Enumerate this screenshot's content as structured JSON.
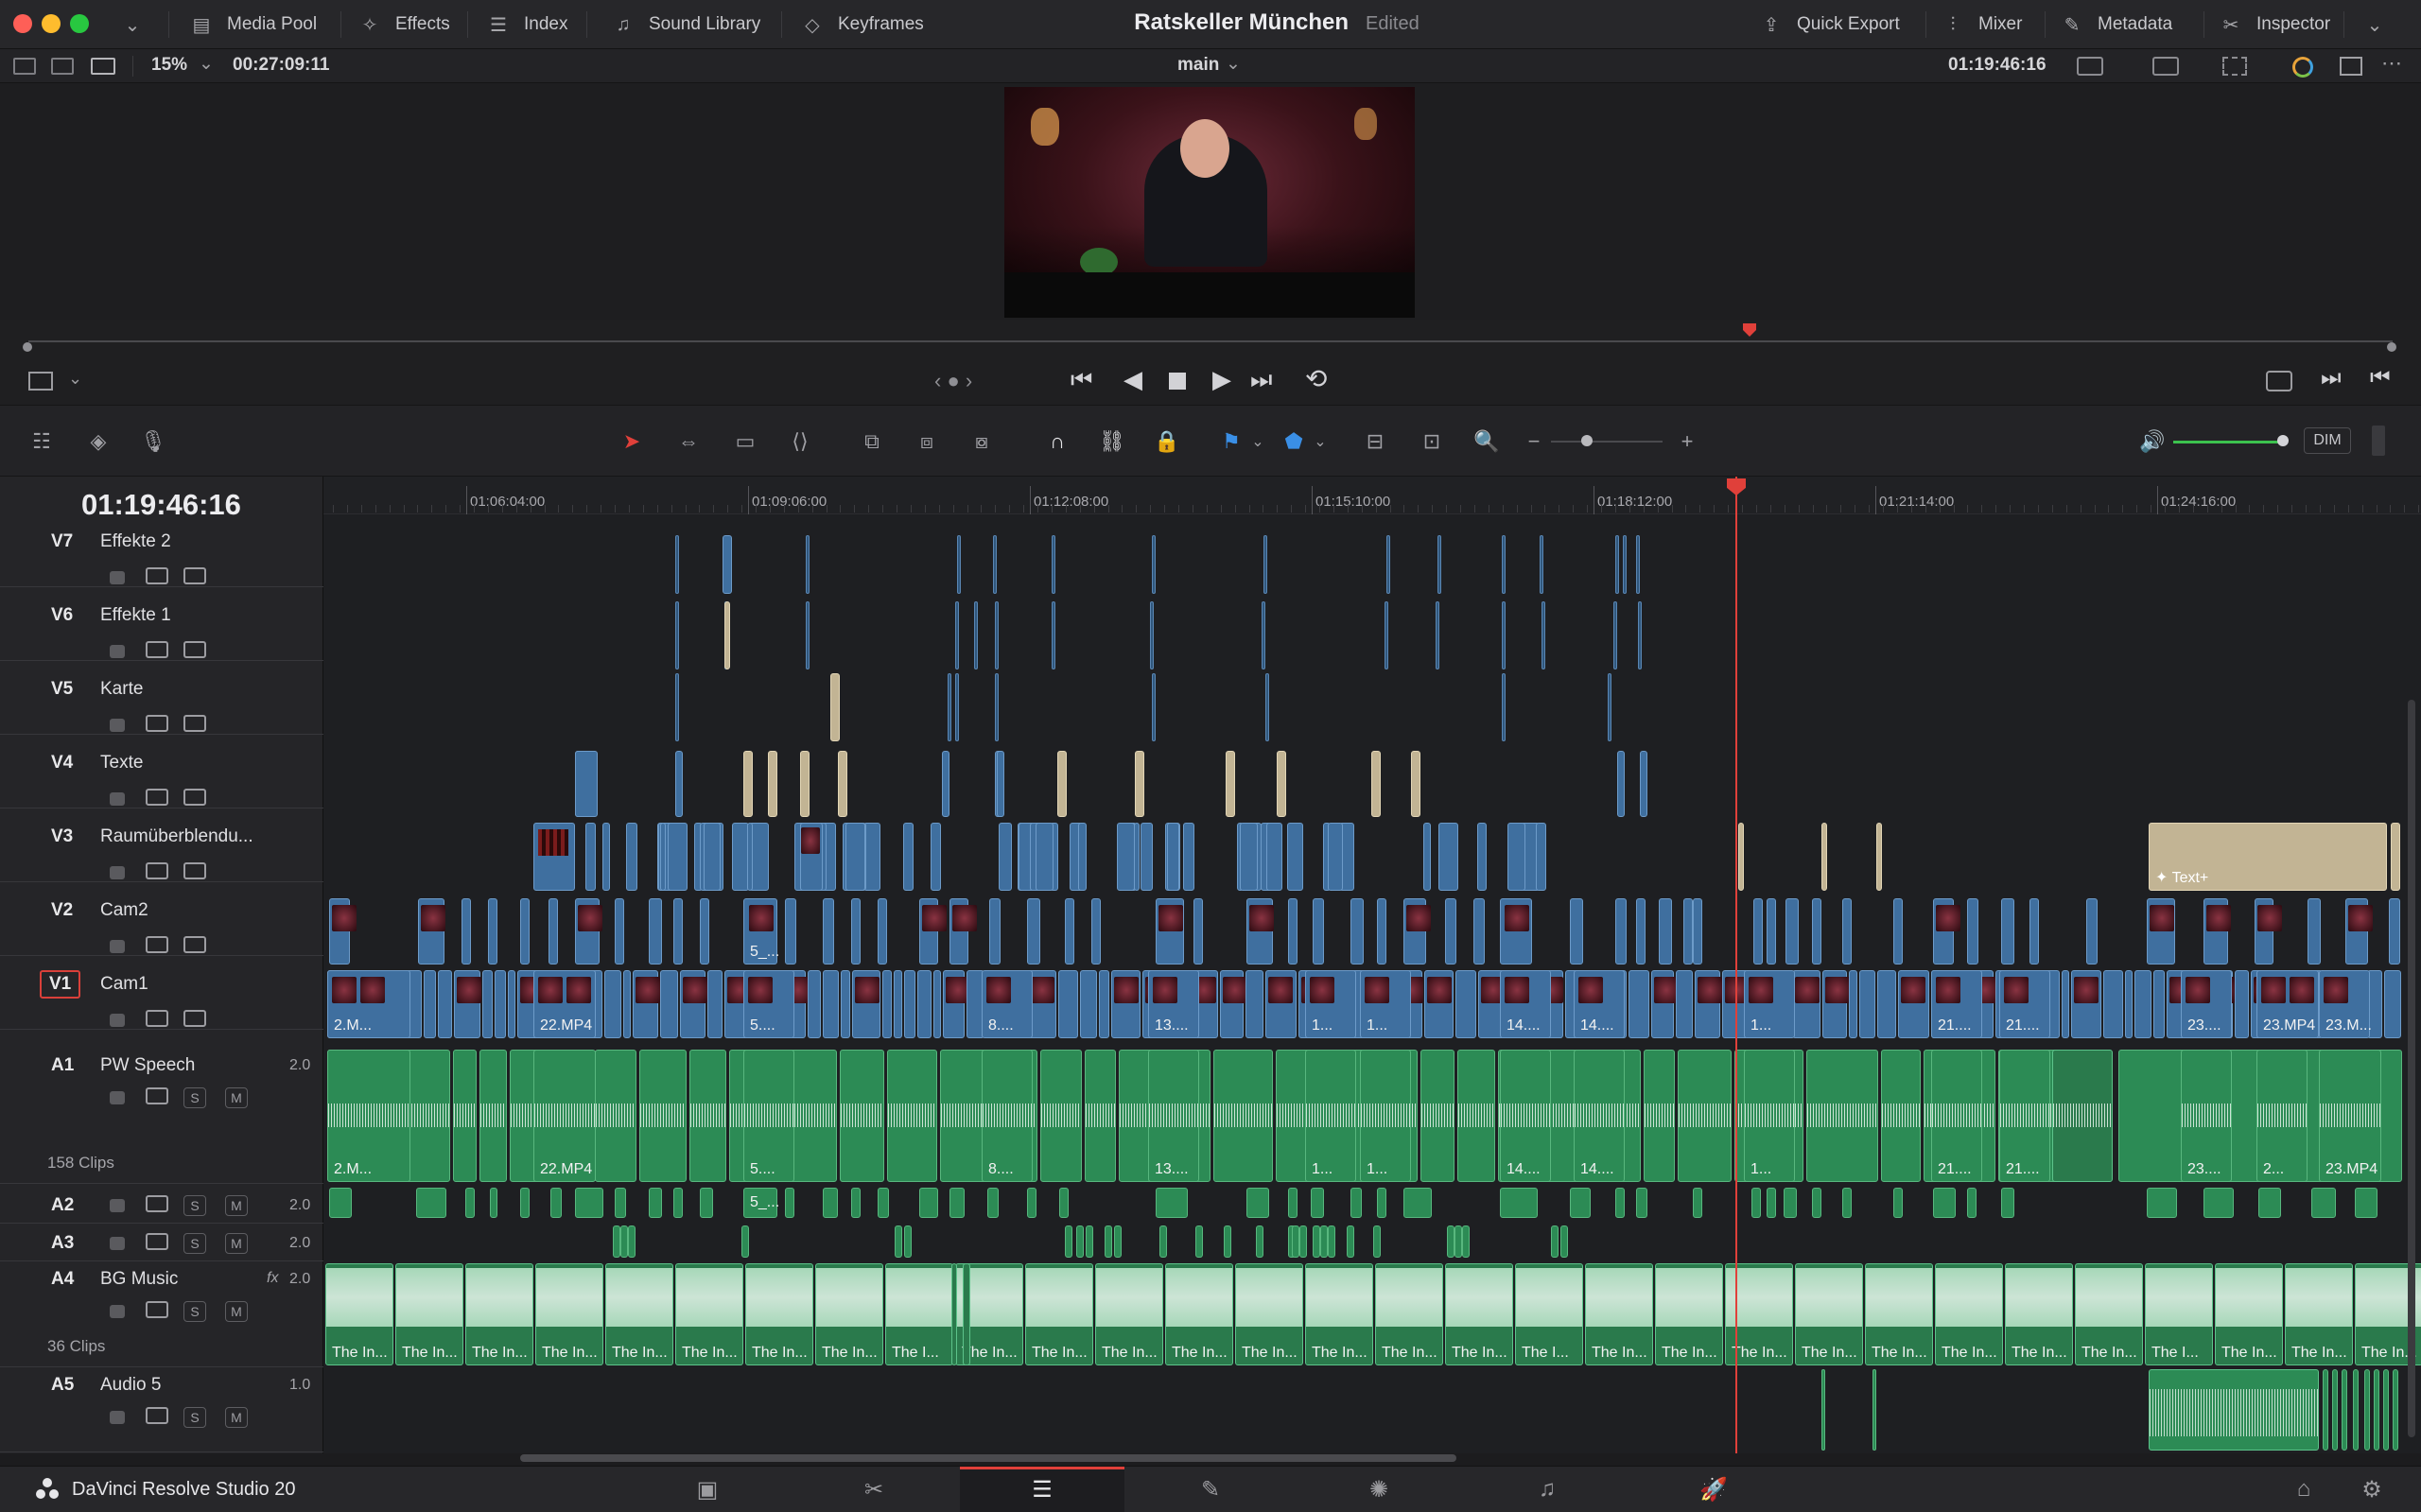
{
  "window": {
    "title": "Ratskeller München",
    "edit_status": "Edited"
  },
  "top_toolbar": {
    "media_pool": "Media Pool",
    "effects": "Effects",
    "index": "Index",
    "sound_library": "Sound Library",
    "keyframes": "Keyframes",
    "quick_export": "Quick Export",
    "mixer": "Mixer",
    "metadata": "Metadata",
    "inspector": "Inspector"
  },
  "viewer_bar": {
    "zoom": "15%",
    "source_duration": "00:27:09:11",
    "timeline_name": "main",
    "timecode": "01:19:46:16"
  },
  "timeline": {
    "current_timecode": "01:19:46:16",
    "ruler_ticks": [
      "01:06:04:00",
      "01:09:06:00",
      "01:12:08:00",
      "01:15:10:00",
      "01:18:12:00",
      "01:21:14:00",
      "01:24:16:00"
    ],
    "dim_label": "DIM",
    "video_tracks": [
      {
        "id": "V7",
        "name": "Effekte 2"
      },
      {
        "id": "V6",
        "name": "Effekte 1"
      },
      {
        "id": "V5",
        "name": "Karte"
      },
      {
        "id": "V4",
        "name": "Texte"
      },
      {
        "id": "V3",
        "name": "Raumüberblendu..."
      },
      {
        "id": "V2",
        "name": "Cam2"
      },
      {
        "id": "V1",
        "name": "Cam1"
      }
    ],
    "audio_tracks": [
      {
        "id": "A1",
        "name": "PW Speech",
        "volume": "2.0",
        "clips": "158 Clips"
      },
      {
        "id": "A2",
        "name": "",
        "volume": "2.0"
      },
      {
        "id": "A3",
        "name": "",
        "volume": "2.0"
      },
      {
        "id": "A4",
        "name": "BG Music",
        "volume": "2.0",
        "fx": "fx",
        "clips": "36 Clips"
      },
      {
        "id": "A5",
        "name": "Audio 5",
        "volume": "1.0"
      }
    ],
    "v1_clip_labels": [
      "2.M...",
      "22.MP4",
      "5....",
      "8....",
      "13....",
      "1...",
      "1...",
      "14....",
      "14....",
      "1...",
      "21....",
      "21....",
      "23....",
      "23.MP4",
      "23.M..."
    ],
    "a1_clip_labels": [
      "2.M...",
      "22.MP4",
      "5....",
      "8....",
      "13....",
      "1...",
      "1...",
      "14....",
      "14....",
      "1...",
      "21....",
      "21....",
      "23....",
      "2...",
      "23.MP4"
    ],
    "v2_label": "5_...",
    "a2_label": "5_...",
    "text_plus_label": "Text+",
    "music_clip_label": "The In...",
    "music_clip_label_short": "The I...",
    "music_clip_label_last": "Th..."
  },
  "footer": {
    "app_name": "DaVinci Resolve Studio 20"
  },
  "colors": {
    "video_clip": "#3f6f9f",
    "text_clip": "#c2b494",
    "audio_clip": "#2c8b55",
    "playhead": "#e0403a"
  }
}
